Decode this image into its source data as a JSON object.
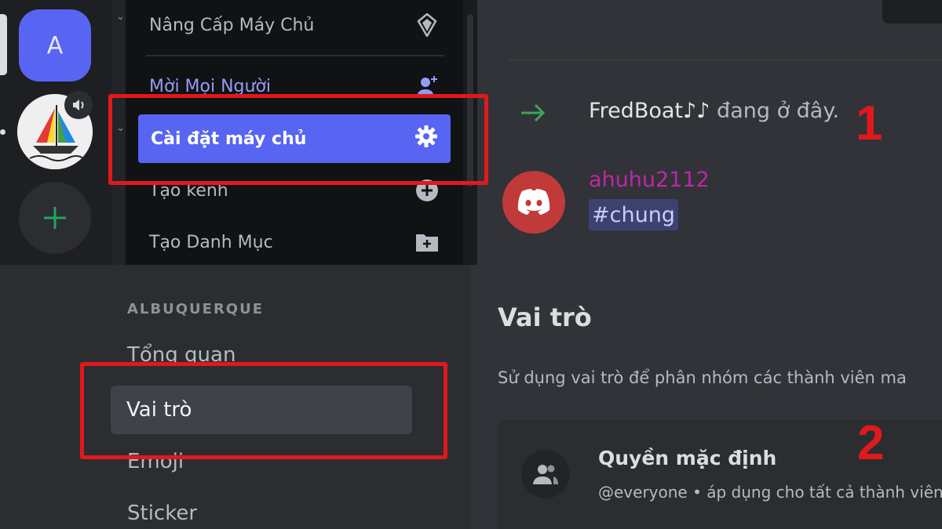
{
  "server_rail": {
    "server_a_letter": "A",
    "server_boat_icon": "sailboat-logo-icon",
    "speaker_icon": "speaker-icon",
    "add_server_icon": "plus-icon"
  },
  "server_menu": {
    "items": [
      {
        "label": "Nâng Cấp Máy Chủ",
        "icon": "boost-icon"
      },
      {
        "label": "Mời Mọi Người",
        "icon": "invite-people-icon"
      },
      {
        "label": "Cài đặt máy chủ",
        "icon": "gear-icon"
      },
      {
        "label": "Tạo kênh",
        "icon": "plus-circle-icon"
      },
      {
        "label": "Tạo Danh Mục",
        "icon": "folder-plus-icon"
      }
    ]
  },
  "chat": {
    "join_user": "FredBoat♪♪",
    "join_suffix": " đang ở đây.",
    "author": "ahuhu2112",
    "channel_mention": "#chung"
  },
  "settings_sidebar": {
    "section": "ALBUQUERQUE",
    "items": [
      "Tổng quan",
      "Vai trò",
      "Emoji",
      "Sticker"
    ]
  },
  "roles_page": {
    "title": "Vai trò",
    "description": "Sử dụng vai trò để phân nhóm các thành viên ma",
    "default_perm_title": "Quyền mặc định",
    "default_perm_sub": "@everyone • áp dụng cho tất cả thành viên"
  },
  "annotations": {
    "step1": "1",
    "step2": "2",
    "highlight_color": "#e0191c"
  },
  "colors": {
    "accent": "#5865f2",
    "mention_bg": "#3c4270",
    "username": "#c026a3",
    "join_arrow": "#3ba55c"
  }
}
